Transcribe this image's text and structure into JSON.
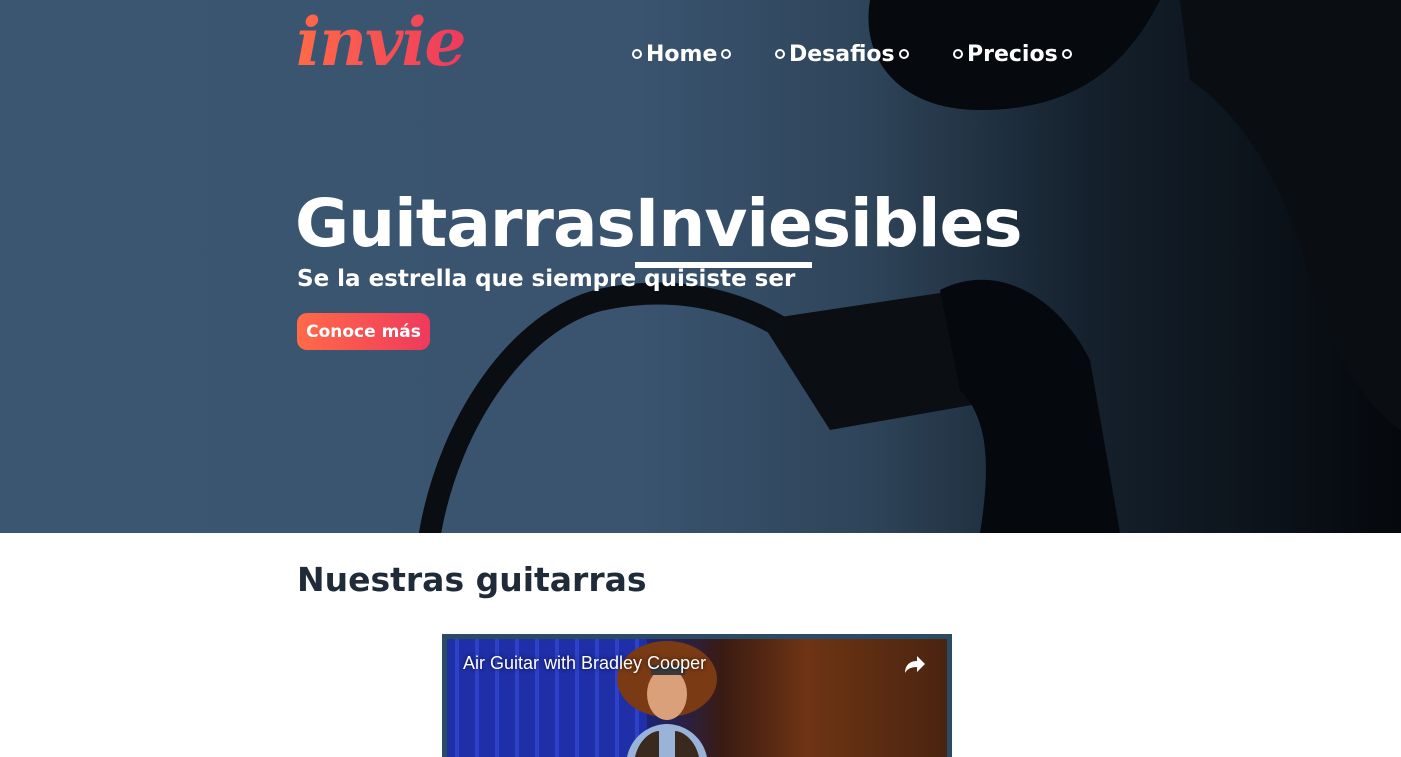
{
  "brand": {
    "logo_text": "invie",
    "accent_start": "#ff6a48",
    "accent_end": "#ef3a5d"
  },
  "nav": {
    "items": [
      {
        "label": "Home"
      },
      {
        "label": "Desafios"
      },
      {
        "label": "Precios"
      }
    ]
  },
  "hero": {
    "title_part1": "Guitarras",
    "title_part2": "Invie",
    "title_part3": "sibles",
    "subtitle": "Se la estrella que siempre quisiste ser",
    "cta_label": "Conoce más",
    "background_color": "#3b5670"
  },
  "section": {
    "title": "Nuestras guitarras"
  },
  "video": {
    "title": "Air Guitar with Bradley Cooper",
    "share_icon": "share-arrow-icon"
  }
}
